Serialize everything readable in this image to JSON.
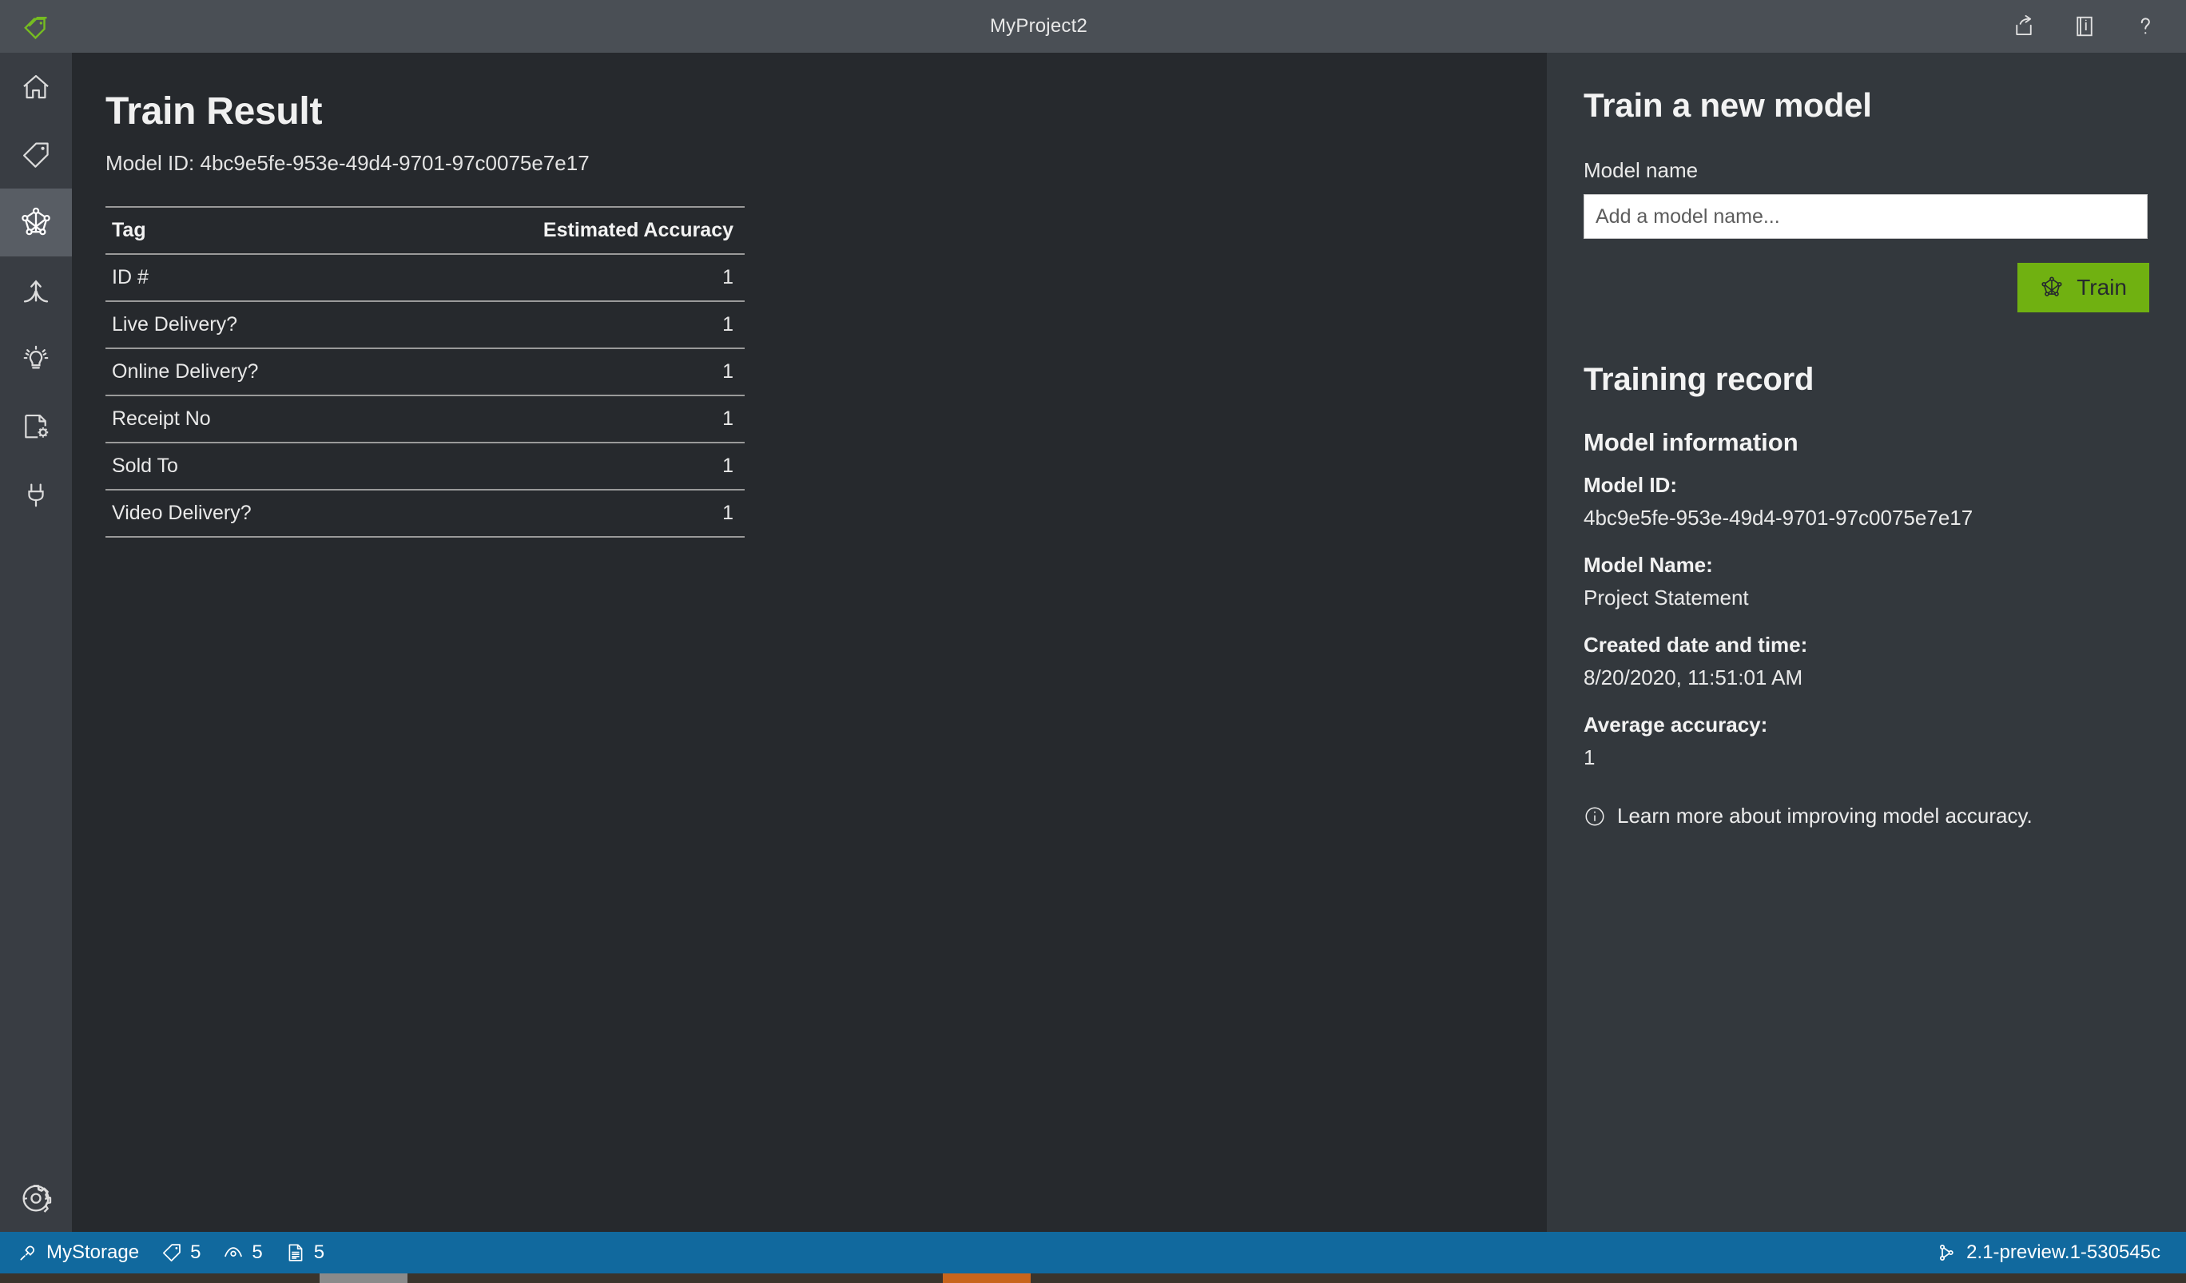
{
  "titlebar": {
    "logo_icon": "tag-logo-icon",
    "title": "MyProject2",
    "actions": [
      {
        "name": "share-export-icon",
        "label": "Share"
      },
      {
        "name": "documentation-icon",
        "label": "Documentation"
      },
      {
        "name": "help-icon",
        "label": "Help"
      }
    ]
  },
  "sidebar": {
    "items": [
      {
        "name": "home-icon",
        "label": "Home",
        "active": false
      },
      {
        "name": "tag-icon",
        "label": "Tag Editor",
        "active": false
      },
      {
        "name": "model-network-icon",
        "label": "Train",
        "active": true
      },
      {
        "name": "analyze-merge-icon",
        "label": "Analyze",
        "active": false
      },
      {
        "name": "lightbulb-icon",
        "label": "Predict",
        "active": false
      },
      {
        "name": "document-settings-icon",
        "label": "Compose",
        "active": false
      },
      {
        "name": "plug-icon",
        "label": "Connections",
        "active": false
      }
    ],
    "settings": {
      "name": "gear-icon",
      "label": "Settings"
    }
  },
  "main": {
    "page_title": "Train Result",
    "model_id_line": "Model ID: 4bc9e5fe-953e-49d4-9701-97c0075e7e17",
    "table": {
      "columns": [
        "Tag",
        "Estimated Accuracy"
      ],
      "rows": [
        {
          "tag": "ID #",
          "accuracy": "1"
        },
        {
          "tag": "Live Delivery?",
          "accuracy": "1"
        },
        {
          "tag": "Online Delivery?",
          "accuracy": "1"
        },
        {
          "tag": "Receipt No",
          "accuracy": "1"
        },
        {
          "tag": "Sold To",
          "accuracy": "1"
        },
        {
          "tag": "Video Delivery?",
          "accuracy": "1"
        }
      ]
    }
  },
  "right_panel": {
    "train_heading": "Train a new model",
    "model_name_label": "Model name",
    "model_name_value": "",
    "model_name_placeholder": "Add a model name...",
    "train_button_label": "Train",
    "training_record_heading": "Training record",
    "model_information_heading": "Model information",
    "fields": [
      {
        "key": "Model ID:",
        "value": "4bc9e5fe-953e-49d4-9701-97c0075e7e17"
      },
      {
        "key": "Model Name:",
        "value": "Project Statement"
      },
      {
        "key": "Created date and time:",
        "value": "8/20/2020, 11:51:01 AM"
      },
      {
        "key": "Average accuracy:",
        "value": "1"
      }
    ],
    "learn_more_text": "Learn more about improving model accuracy."
  },
  "statusbar": {
    "storage_icon": "plug-connection-icon",
    "storage_label": "MyStorage",
    "tag_count": "5",
    "eye_count": "5",
    "document_count": "5",
    "version_icon": "git-branch-icon",
    "version": "2.1-preview.1-530545c"
  },
  "colors": {
    "accent_green": "#70b111",
    "status_blue": "#11699e",
    "titlebar_gray": "#4a4f55",
    "sidebar_gray": "#393d43",
    "sidebar_active": "#585d64",
    "main_bg": "#26292d",
    "panel_bg": "#33383d"
  }
}
